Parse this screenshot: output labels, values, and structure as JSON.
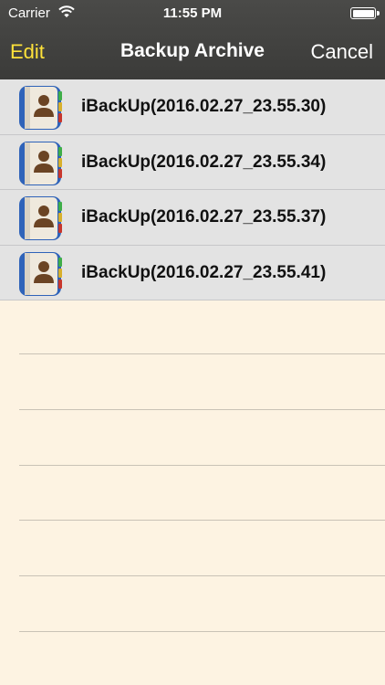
{
  "status_bar": {
    "carrier": "Carrier",
    "time": "11:55 PM",
    "icons": [
      "wifi-icon",
      "battery-icon"
    ]
  },
  "nav": {
    "edit_label": "Edit",
    "title": "Backup Archive",
    "cancel_label": "Cancel"
  },
  "colors": {
    "nav_background": "#3f3f3d",
    "edit_accent": "#ffe23a",
    "list_row_background": "#e3e3e3",
    "paper_background": "#fdf3e2"
  },
  "backups": [
    {
      "label": "iBackUp(2016.02.27_23.55.30)",
      "icon": "contacts-book-icon"
    },
    {
      "label": "iBackUp(2016.02.27_23.55.34)",
      "icon": "contacts-book-icon"
    },
    {
      "label": "iBackUp(2016.02.27_23.55.37)",
      "icon": "contacts-book-icon"
    },
    {
      "label": "iBackUp(2016.02.27_23.55.41)",
      "icon": "contacts-book-icon"
    }
  ]
}
